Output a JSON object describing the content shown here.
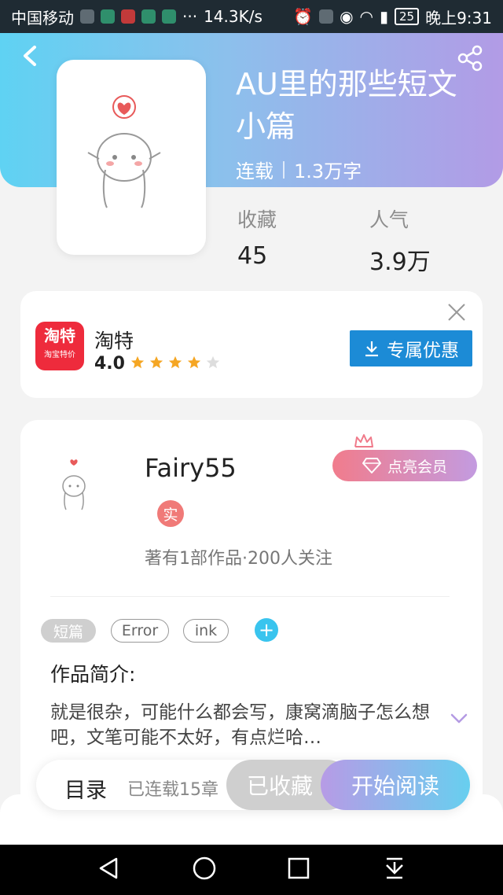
{
  "status_bar": {
    "carrier": "中国移动",
    "speed": "14.3K/s",
    "battery": "25",
    "time": "晚上9:31",
    "icons": [
      "hd-icon",
      "eye-icon",
      "wifi-icon",
      "signal-icon",
      "alarm-icon"
    ]
  },
  "book": {
    "title": "AU里的那些短文小篇",
    "status": "连载",
    "word_count": "1.3万字",
    "stats": [
      {
        "label": "收藏",
        "value": "45"
      },
      {
        "label": "人气",
        "value": "3.9万"
      }
    ]
  },
  "ad": {
    "app_icon_text": "淘特",
    "app_icon_sub": "淘宝特价",
    "app_name": "淘特",
    "rating": "4.0",
    "stars_filled": 4,
    "stars_total": 5,
    "button_label": "专属优惠"
  },
  "author": {
    "name": "Fairy55",
    "verified_badge": "实",
    "info": "著有1部作品·200人关注",
    "vip_label": "点亮会员"
  },
  "tags": {
    "items": [
      "短篇",
      "Error",
      "ink"
    ],
    "add_symbol": "+"
  },
  "intro": {
    "title": "作品简介:",
    "text": "就是很杂，可能什么都会写，康窝滴脑子怎么想吧，文笔可能不太好，有点烂哈…"
  },
  "bottom_bar": {
    "toc_label": "目录",
    "toc_count": "已连载15章",
    "saved_label": "已收藏",
    "read_label": "开始阅读"
  },
  "colors": {
    "header_start": "#5fd2f3",
    "header_end": "#b29be6",
    "ad_button": "#1c8bd6",
    "accent_blue": "#39c4ee",
    "star": "#f5a623"
  }
}
